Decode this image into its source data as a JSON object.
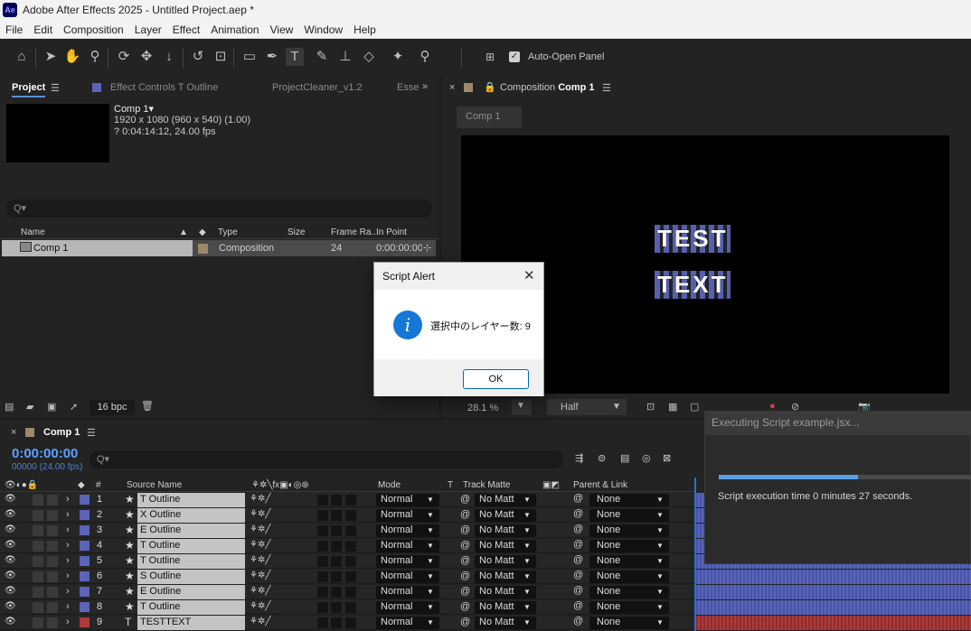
{
  "titlebar": {
    "title": "Adobe After Effects 2025 - Untitled Project.aep *",
    "logo": "Ae"
  },
  "menu": [
    "File",
    "Edit",
    "Composition",
    "Layer",
    "Effect",
    "Animation",
    "View",
    "Window",
    "Help"
  ],
  "toolbar": {
    "auto_open_label": "Auto-Open Panel"
  },
  "project_panel": {
    "tabs": [
      "Project",
      "Effect Controls T Outline",
      "ProjectCleaner_v1.2",
      "Esse"
    ],
    "comp_name": "Comp 1▾",
    "comp_res": "1920 x 1080  (960 x 540) (1.00)",
    "comp_duration": "? 0:04:14:12, 24.00 fps",
    "search_placeholder": "Q▾",
    "headers": {
      "name": "Name",
      "type": "Type",
      "size": "Size",
      "frame_rate": "Frame Ra...",
      "in_point": "In Point"
    },
    "row": {
      "name": "Comp 1",
      "type": "Composition",
      "frame_rate": "24",
      "in_point": "0:00:00:00"
    },
    "bpc": "16 bpc"
  },
  "comp_panel": {
    "tab_prefix": "Composition",
    "tab_name": "Comp 1",
    "chip": "Comp 1",
    "zoom": "28.1 %",
    "quality": "Half",
    "canvas_text_1": "TEST",
    "canvas_text_2": "TEXT"
  },
  "timeline": {
    "tab": "Comp 1",
    "timecode": "0:00:00:00",
    "fps": "00000 (24.00 fps)",
    "search_placeholder": "Q▾",
    "headers": {
      "num": "#",
      "source": "Source Name",
      "mode": "Mode",
      "t": "T",
      "track_matte": "Track Matte",
      "parent": "Parent & Link"
    },
    "layers": [
      {
        "num": "1",
        "name": "T Outline",
        "mode": "Normal",
        "matte": "No Matt",
        "parent": "None",
        "label_color": "#5b64b8",
        "track": "#4755a6"
      },
      {
        "num": "2",
        "name": "X Outline",
        "mode": "Normal",
        "matte": "No Matt",
        "parent": "None",
        "label_color": "#5b64b8",
        "track": "#4755a6"
      },
      {
        "num": "3",
        "name": "E Outline",
        "mode": "Normal",
        "matte": "No Matt",
        "parent": "None",
        "label_color": "#5b64b8",
        "track": "#4755a6"
      },
      {
        "num": "4",
        "name": "T Outline",
        "mode": "Normal",
        "matte": "No Matt",
        "parent": "None",
        "label_color": "#5b64b8",
        "track": "#4755a6"
      },
      {
        "num": "5",
        "name": "T Outline",
        "mode": "Normal",
        "matte": "No Matt",
        "parent": "None",
        "label_color": "#5b64b8",
        "track": "#4755a6"
      },
      {
        "num": "6",
        "name": "S Outline",
        "mode": "Normal",
        "matte": "No Matt",
        "parent": "None",
        "label_color": "#5b64b8",
        "track": "#4755a6"
      },
      {
        "num": "7",
        "name": "E Outline",
        "mode": "Normal",
        "matte": "No Matt",
        "parent": "None",
        "label_color": "#5b64b8",
        "track": "#4755a6"
      },
      {
        "num": "8",
        "name": "T Outline",
        "mode": "Normal",
        "matte": "No Matt",
        "parent": "None",
        "label_color": "#5b64b8",
        "track": "#4755a6"
      },
      {
        "num": "9",
        "name": "TESTTEXT",
        "mode": "Normal",
        "matte": "No Matt",
        "parent": "None",
        "label_color": "#b03a3a",
        "track": "#8a2f2f"
      }
    ]
  },
  "dialog": {
    "title": "Script Alert",
    "message": "選択中のレイヤー数: 9",
    "ok": "OK",
    "icon": "i"
  },
  "progress": {
    "title": "Executing Script example.jsx...",
    "message": "Script execution time 0 minutes 27 seconds.",
    "fraction": 0.55
  }
}
